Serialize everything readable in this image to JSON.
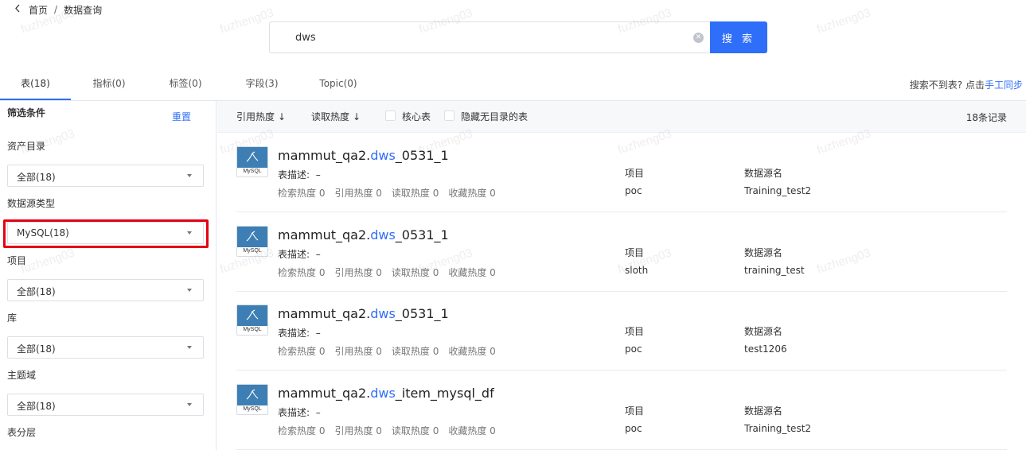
{
  "breadcrumb": {
    "home": "首页",
    "separator": "/",
    "current": "数据查询"
  },
  "search": {
    "value": "dws",
    "button_label": "搜 索"
  },
  "tabs": [
    {
      "label": "表(18)",
      "active": true
    },
    {
      "label": "指标(0)"
    },
    {
      "label": "标签(0)"
    },
    {
      "label": "字段(3)"
    },
    {
      "label": "Topic(0)"
    }
  ],
  "tab_hint": {
    "text": "搜索不到表? 点击",
    "link": "手工同步"
  },
  "sidebar": {
    "title": "筛选条件",
    "reset": "重置",
    "filters": [
      {
        "label": "资产目录",
        "value": "全部(18)"
      },
      {
        "label": "数据源类型",
        "value": "MySQL(18)"
      },
      {
        "label": "项目",
        "value": "全部(18)"
      },
      {
        "label": "库",
        "value": "全部(18)"
      },
      {
        "label": "主题域",
        "value": "全部(18)"
      },
      {
        "label": "表分层"
      }
    ]
  },
  "sort_bar": {
    "sort_reference": "引用热度",
    "sort_read": "读取热度",
    "arrow": "↓",
    "core_table": "核心表",
    "hide_no_catalog": "隐藏无目录的表",
    "record_count": "18条记录"
  },
  "result_common": {
    "icon_text": "MySQL",
    "desc_label": "表描述:",
    "desc_value": "–",
    "stat_search": "检索热度 0",
    "stat_reference": "引用热度 0",
    "stat_read": "读取热度 0",
    "stat_favorite": "收藏热度 0",
    "project_label": "项目",
    "datasource_label": "数据源名"
  },
  "results": [
    {
      "prefix": "mammut_qa2.",
      "highlight": "dws",
      "suffix": "_0531_1",
      "project": "poc",
      "datasource": "Training_test2"
    },
    {
      "prefix": "mammut_qa2.",
      "highlight": "dws",
      "suffix": "_0531_1",
      "project": "sloth",
      "datasource": "training_test"
    },
    {
      "prefix": "mammut_qa2.",
      "highlight": "dws",
      "suffix": "_0531_1",
      "project": "poc",
      "datasource": "test1206"
    },
    {
      "prefix": "mammut_qa2.",
      "highlight": "dws",
      "suffix": "_item_mysql_df",
      "project": "poc",
      "datasource": "Training_test2"
    }
  ],
  "watermark": "fuzheng03",
  "colors": {
    "accent": "#2f6ef8",
    "highlight_border": "#e60012",
    "mysql_icon": "#3d7fb4"
  }
}
